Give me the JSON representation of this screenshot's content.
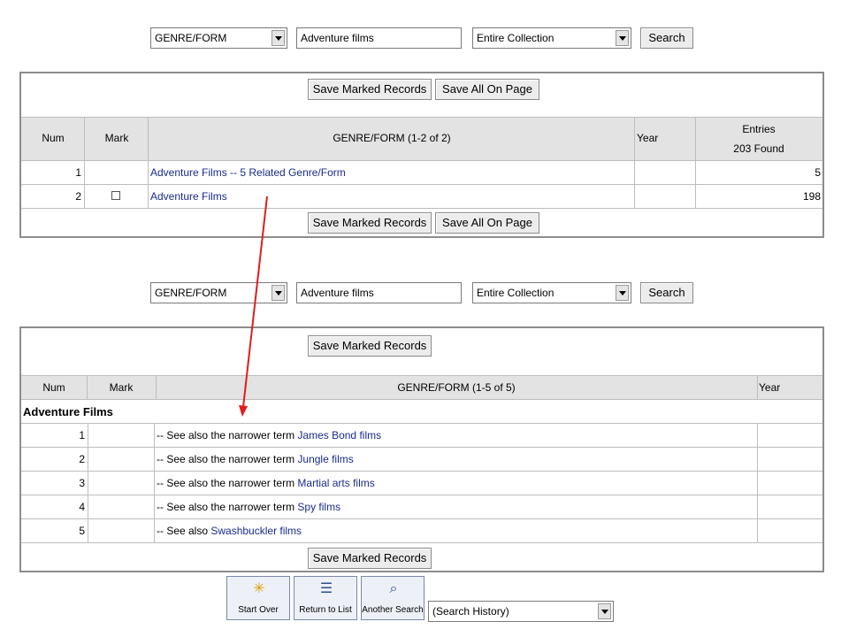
{
  "search1": {
    "field": "GENRE/FORM",
    "query": "Adventure films",
    "scope": "Entire Collection",
    "button": "Search"
  },
  "search2": {
    "field": "GENRE/FORM",
    "query": "Adventure films",
    "scope": "Entire Collection",
    "button": "Search"
  },
  "table1": {
    "save_marked": "Save Marked Records",
    "save_all": "Save All On Page",
    "headers": {
      "num": "Num",
      "mark": "Mark",
      "genre": "GENRE/FORM (1-2 of 2)",
      "year": "Year",
      "entries_line1": "Entries",
      "entries_line2": "203 Found"
    },
    "rows": [
      {
        "num": "1",
        "genre": "Adventure Films -- 5 Related Genre/Form",
        "entries": "5"
      },
      {
        "num": "2",
        "genre": "Adventure Films",
        "entries": "198"
      }
    ]
  },
  "table2": {
    "save_marked": "Save Marked Records",
    "headers": {
      "num": "Num",
      "mark": "Mark",
      "genre": "GENRE/FORM (1-5 of 5)",
      "year": "Year"
    },
    "group_heading": "Adventure Films",
    "rows": [
      {
        "num": "1",
        "prefix": "-- See also the narrower term ",
        "link": "James Bond films"
      },
      {
        "num": "2",
        "prefix": "-- See also the narrower term ",
        "link": "Jungle films"
      },
      {
        "num": "3",
        "prefix": "-- See also the narrower term ",
        "link": "Martial arts films"
      },
      {
        "num": "4",
        "prefix": "-- See also the narrower term ",
        "link": "Spy films"
      },
      {
        "num": "5",
        "prefix": "-- See also ",
        "link": "Swashbuckler films"
      }
    ]
  },
  "toolbar": {
    "start_over": "Start Over",
    "return_to_list": "Return to List",
    "another_search": "Another Search",
    "history": "(Search History)"
  },
  "colors": {
    "link": "#1a2a8c",
    "header_bg": "#e3e3e3",
    "arrow": "#e31b1b"
  }
}
